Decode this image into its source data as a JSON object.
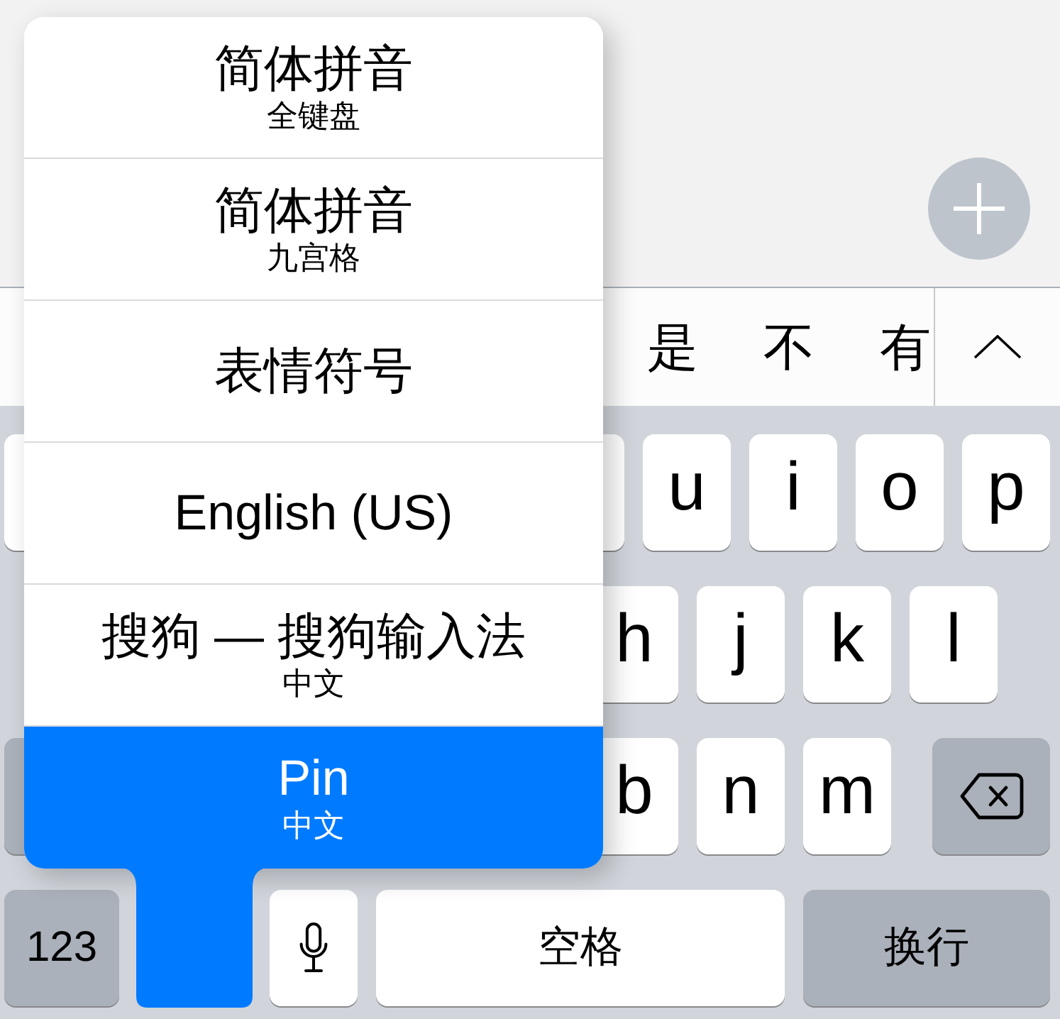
{
  "candidate_bar": {
    "candidates": [
      "是",
      "不",
      "有"
    ]
  },
  "keyboard": {
    "row_1": [
      {
        "kind": "blank"
      },
      {
        "kind": "blank"
      },
      {
        "kind": "letter",
        "label": "u"
      },
      {
        "kind": "letter",
        "label": "i"
      },
      {
        "kind": "letter",
        "label": "o"
      },
      {
        "kind": "letter",
        "label": "p"
      }
    ],
    "row_2": [
      {
        "kind": "letter",
        "label": "h"
      },
      {
        "kind": "letter",
        "label": "j"
      },
      {
        "kind": "letter",
        "label": "k"
      },
      {
        "kind": "letter",
        "label": "l"
      }
    ],
    "row_3": [
      {
        "kind": "modifier"
      },
      {
        "kind": "letter",
        "label": "b"
      },
      {
        "kind": "letter",
        "label": "n"
      },
      {
        "kind": "letter",
        "label": "m"
      },
      {
        "kind": "delete"
      }
    ],
    "row_4": [
      {
        "kind": "function",
        "label": "123"
      },
      {
        "kind": "mic"
      },
      {
        "kind": "space",
        "label": "空格"
      },
      {
        "kind": "return",
        "label": "换行"
      }
    ]
  },
  "input_menu": {
    "items": [
      {
        "title": "简体拼音",
        "subtitle": "全键盘",
        "selected": false
      },
      {
        "title": "简体拼音",
        "subtitle": "九宫格",
        "selected": false
      },
      {
        "title": "表情符号",
        "selected": false
      },
      {
        "title": "English (US)",
        "selected": false
      },
      {
        "title": "搜狗 — 搜狗输入法",
        "subtitle": "中文",
        "selected": false
      },
      {
        "title": "Pin",
        "subtitle": "中文",
        "selected": true
      }
    ]
  }
}
